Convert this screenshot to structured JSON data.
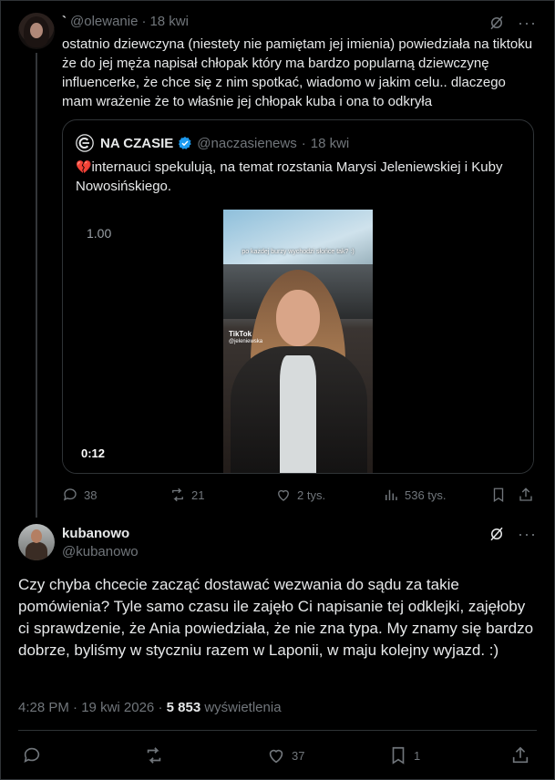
{
  "parent_tweet": {
    "display_name": "`",
    "handle": "@olewanie",
    "separator": "·",
    "time": "18 kwi",
    "text": "ostatnio dziewczyna (niestety nie pamiętam jej imienia) powiedziała na tiktoku że do jej męża napisał chłopak który ma bardzo popularną dziewczynę influencerke, że chce się z nim spotkać, wiadomo w jakim celu.. dlaczego mam wrażenie że to właśnie jej chłopak kuba i ona to odkryła",
    "quote": {
      "name": "NA CZASIE",
      "handle": "@naczasienews",
      "separator": "·",
      "time": "18 kwi",
      "emoji": "💔",
      "text": "internauci spekulują, na temat rozstania Marysi Jeleniewskiej i Kuby Nowosińskiego.",
      "media": {
        "rate": "1.00",
        "duration": "0:12",
        "caption": "po każdej burzy wychodzi słońce tak? :)",
        "tiktok_label": "TikTok",
        "tiktok_user": "@jeleniewska"
      }
    },
    "actions": {
      "replies": "38",
      "reposts": "21",
      "likes": "2 tys.",
      "views": "536 tys."
    }
  },
  "reply_tweet": {
    "display_name": "kubanowo",
    "handle": "@kubanowo",
    "text": "Czy chyba chcecie zacząć dostawać wezwania do sądu za takie pomówienia? Tyle samo czasu ile zajęło Ci napisanie tej odklejki, zajęłoby ci sprawdzenie, że Ania powiedziała, że nie zna typa. My znamy się bardzo dobrze, byliśmy w styczniu razem w Laponii, w maju kolejny wyjazd. :)",
    "time": "4:28 PM",
    "date": "19 kwi 2026",
    "views_count": "5 853",
    "views_label": "wyświetlenia",
    "actions": {
      "replies": "",
      "reposts": "",
      "likes": "37",
      "bookmarks": "1"
    }
  },
  "colors": {
    "background": "#000000",
    "text": "#e7e9ea",
    "muted": "#71767b",
    "border": "#2f3336",
    "verified": "#1d9bf0"
  }
}
